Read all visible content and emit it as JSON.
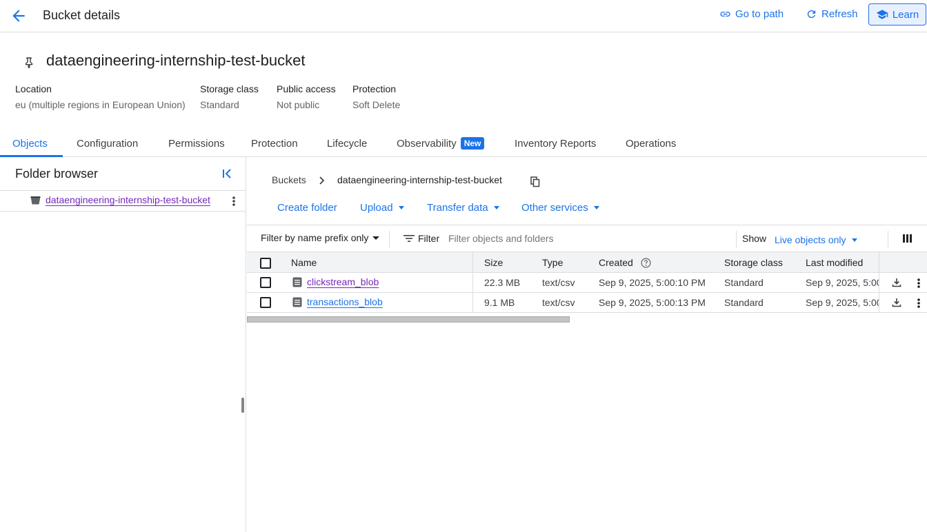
{
  "header": {
    "title": "Bucket details",
    "go_to_path": "Go to path",
    "refresh": "Refresh",
    "learn": "Learn"
  },
  "bucket": {
    "name": "dataengineering-internship-test-bucket",
    "meta": [
      {
        "label": "Location",
        "value": "eu (multiple regions in European Union)"
      },
      {
        "label": "Storage class",
        "value": "Standard"
      },
      {
        "label": "Public access",
        "value": "Not public"
      },
      {
        "label": "Protection",
        "value": "Soft Delete"
      }
    ]
  },
  "tabs": [
    {
      "label": "Objects",
      "active": true
    },
    {
      "label": "Configuration"
    },
    {
      "label": "Permissions"
    },
    {
      "label": "Protection"
    },
    {
      "label": "Lifecycle"
    },
    {
      "label": "Observability",
      "badge": "New"
    },
    {
      "label": "Inventory Reports"
    },
    {
      "label": "Operations"
    }
  ],
  "folder_browser": {
    "title": "Folder browser",
    "bucket": "dataengineering-internship-test-bucket"
  },
  "breadcrumb": {
    "root": "Buckets",
    "current": "dataengineering-internship-test-bucket"
  },
  "actions": {
    "create_folder": "Create folder",
    "upload": "Upload",
    "transfer_data": "Transfer data",
    "other_services": "Other services"
  },
  "filter": {
    "prefix_mode": "Filter by name prefix only",
    "filter_label": "Filter",
    "placeholder": "Filter objects and folders",
    "show_label": "Show",
    "show_value": "Live objects only"
  },
  "table": {
    "columns": [
      "Name",
      "Size",
      "Type",
      "Created",
      "Storage class",
      "Last modified"
    ],
    "rows": [
      {
        "name": "clickstream_blob",
        "size": "22.3 MB",
        "type": "text/csv",
        "created": "Sep 9, 2025, 5:00:10 PM",
        "storage_class": "Standard",
        "last_modified": "Sep 9, 2025, 5:00"
      },
      {
        "name": "transactions_blob",
        "size": "9.1 MB",
        "type": "text/csv",
        "created": "Sep 9, 2025, 5:00:13 PM",
        "storage_class": "Standard",
        "last_modified": "Sep 9, 2025, 5:00"
      }
    ]
  },
  "colors": {
    "accent": "#1a73e8",
    "visited_link": "#7627bb",
    "border": "#dadce0",
    "header_row": "#f1f3f4"
  }
}
